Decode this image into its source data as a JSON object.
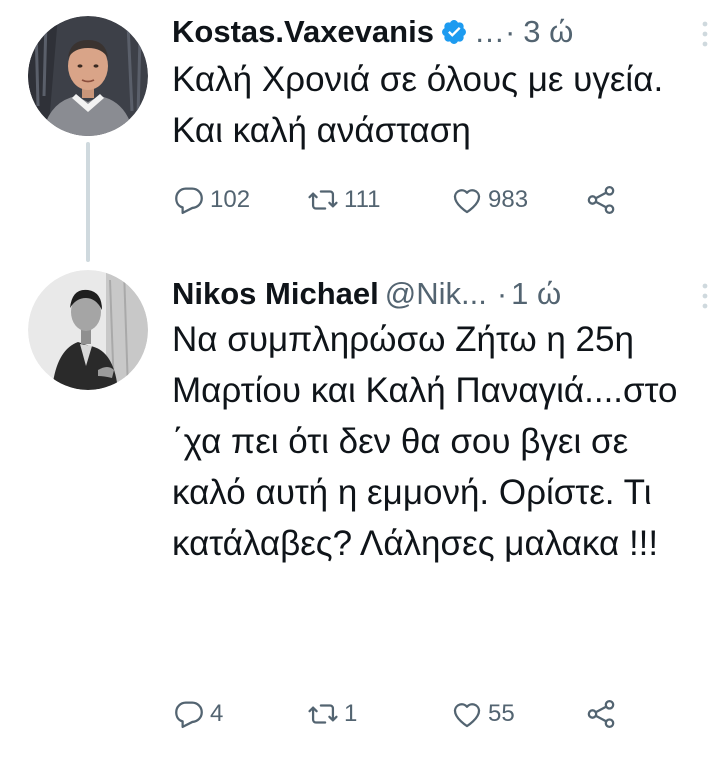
{
  "tweets": [
    {
      "display_name": "Kostas.Vaxevanis",
      "handle": "…·",
      "time": "3 ώ",
      "text": "Καλή Χρονιά σε όλους με υγεία. Και καλή ανάσταση",
      "replies": "102",
      "retweets": "111",
      "likes": "983",
      "verified": true,
      "icons": [
        "reply-icon",
        "retweet-icon",
        "like-icon",
        "share-icon",
        "more-icon",
        "verified-badge-icon"
      ]
    },
    {
      "display_name": "Nikos Michael",
      "handle": "@Nik...",
      "dot": "·",
      "time": "1 ώ",
      "text": "Να συμπληρώσω Ζήτω η 25η Μαρτίου και Καλή Παναγιά....στο ΄χα πει ότι δεν θα σου βγει σε καλό αυτή η εμμονή. Ορίστε. Τι κατάλαβες? Λάλησες μαλακα !!!",
      "replies": "4",
      "retweets": "1",
      "likes": "55",
      "verified": false,
      "icons": [
        "reply-icon",
        "retweet-icon",
        "like-icon",
        "share-icon",
        "more-icon"
      ]
    }
  ],
  "colors": {
    "text": "#0f1419",
    "secondary": "#536471",
    "verified": "#1d9bf0",
    "thread_line": "#cfd9de",
    "background": "#ffffff"
  }
}
